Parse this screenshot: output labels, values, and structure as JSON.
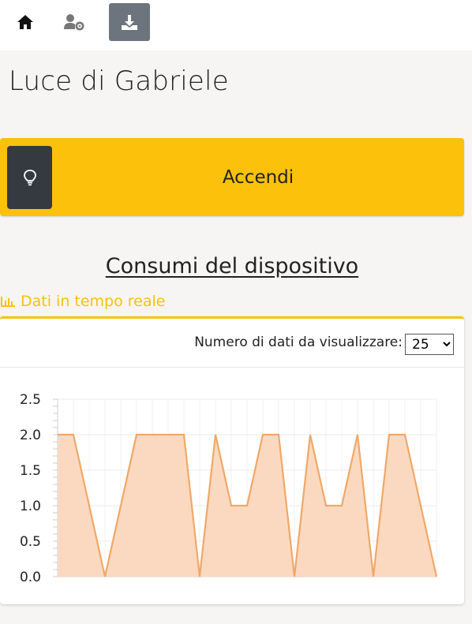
{
  "nav": {
    "home_icon": "home-icon",
    "user_settings_icon": "user-cog-icon",
    "download_icon": "download-icon"
  },
  "page": {
    "title": "Luce di Gabriele"
  },
  "toggle": {
    "label": "Accendi",
    "icon": "lightbulb-icon",
    "accent": "#fcc10a",
    "icon_bg": "#343a40"
  },
  "consumption": {
    "title": "Consumi del dispositivo",
    "realtime_label": "Dati in tempo reale",
    "realtime_icon": "bar-chart-icon",
    "count_label": "Numero di dati da visualizzare:",
    "count_selected": "25"
  },
  "chart_data": {
    "type": "area",
    "x": [
      1,
      2,
      3,
      4,
      5,
      6,
      7,
      8,
      9,
      10,
      11,
      12,
      13,
      14,
      15,
      16,
      17,
      18,
      19,
      20,
      21,
      22,
      23,
      24,
      25
    ],
    "series": [
      {
        "values": [
          2,
          2,
          1,
          0,
          1,
          2,
          2,
          2,
          2,
          0,
          2,
          1,
          1,
          2,
          2,
          0,
          2,
          1,
          1,
          2,
          0,
          2,
          2,
          1,
          0
        ]
      }
    ],
    "ylim": [
      0,
      2.5
    ],
    "yticks": [
      "0.0",
      "0.5",
      "1.0",
      "1.5",
      "2.0",
      "2.5"
    ],
    "grid": true,
    "line_color": "#f0a868",
    "fill_color": "#fbd9c0"
  }
}
